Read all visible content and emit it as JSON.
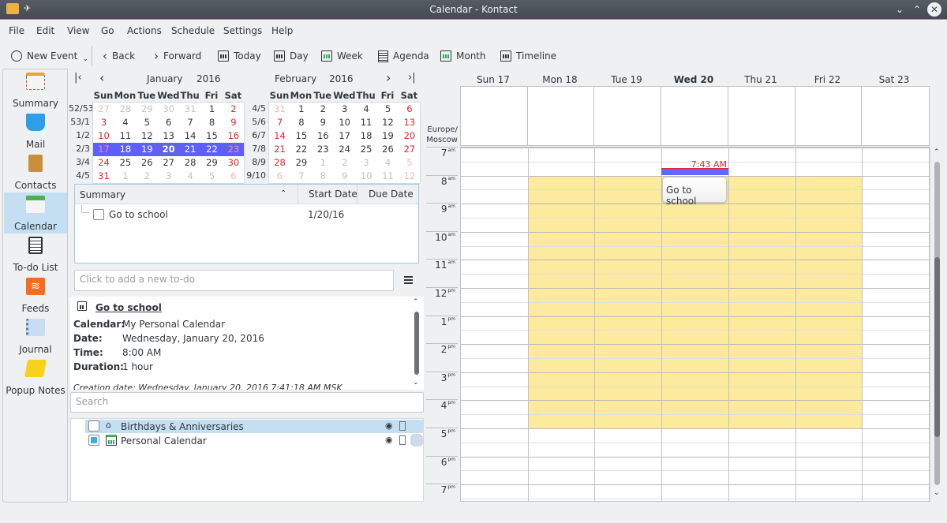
{
  "window": {
    "title": "Calendar - Kontact"
  },
  "menu": [
    "File",
    "Edit",
    "View",
    "Go",
    "Actions",
    "Schedule",
    "Settings",
    "Help"
  ],
  "toolbar": {
    "new_event": "New Event",
    "back": "Back",
    "forward": "Forward",
    "today": "Today",
    "day": "Day",
    "week": "Week",
    "agenda": "Agenda",
    "month": "Month",
    "timeline": "Timeline"
  },
  "sidebar": [
    {
      "label": "Summary",
      "icon": "summary-icon"
    },
    {
      "label": "Mail",
      "icon": "mail-icon"
    },
    {
      "label": "Contacts",
      "icon": "contacts-icon"
    },
    {
      "label": "Calendar",
      "icon": "calendar-icon",
      "active": true
    },
    {
      "label": "To-do List",
      "icon": "todo-icon"
    },
    {
      "label": "Feeds",
      "icon": "feeds-icon"
    },
    {
      "label": "Journal",
      "icon": "journal-icon"
    },
    {
      "label": "Popup Notes",
      "icon": "popup-notes-icon"
    }
  ],
  "mini_calendar": {
    "day_headers": [
      "Sun",
      "Mon",
      "Tue",
      "Wed",
      "Thu",
      "Fri",
      "Sat"
    ],
    "months": [
      {
        "month": "January",
        "year": "2016",
        "weeks": [
          "52/53",
          "53/1",
          "1/2",
          "2/3",
          "3/4",
          "4/5"
        ],
        "days": [
          [
            27,
            28,
            29,
            30,
            31,
            1,
            2
          ],
          [
            3,
            4,
            5,
            6,
            7,
            8,
            9
          ],
          [
            10,
            11,
            12,
            13,
            14,
            15,
            16
          ],
          [
            17,
            18,
            19,
            20,
            21,
            22,
            23
          ],
          [
            24,
            25,
            26,
            27,
            28,
            29,
            30
          ],
          [
            31,
            1,
            2,
            3,
            4,
            5,
            6
          ]
        ],
        "first_in": 5,
        "last_in": 36,
        "selected_week": 3,
        "today": 20
      },
      {
        "month": "February",
        "year": "2016",
        "weeks": [
          "4/5",
          "5/6",
          "6/7",
          "7/8",
          "8/9",
          "9/10"
        ],
        "days": [
          [
            31,
            1,
            2,
            3,
            4,
            5,
            6
          ],
          [
            7,
            8,
            9,
            10,
            11,
            12,
            13
          ],
          [
            14,
            15,
            16,
            17,
            18,
            19,
            20
          ],
          [
            21,
            22,
            23,
            24,
            25,
            26,
            27
          ],
          [
            28,
            29,
            1,
            2,
            3,
            4,
            5
          ],
          [
            6,
            7,
            8,
            9,
            10,
            11,
            12
          ]
        ],
        "first_in": 1,
        "last_in": 29
      }
    ]
  },
  "todo": {
    "columns": [
      "Summary",
      "Start Date",
      "Due Date"
    ],
    "items": [
      {
        "summary": "Go to school",
        "start": "1/20/16",
        "due": ""
      }
    ],
    "add_placeholder": "Click to add a new to-do"
  },
  "details": {
    "title": "Go to school",
    "calendar_label": "Calendar:",
    "calendar": "My Personal Calendar",
    "date_label": "Date:",
    "date": "Wednesday, January 20, 2016",
    "time_label": "Time:",
    "time": "8:00 AM",
    "duration_label": "Duration:",
    "duration": "1 hour",
    "creation": "Creation date: Wednesday, January 20, 2016 7:41:18 AM MSK"
  },
  "calendars": {
    "search_placeholder": "Search",
    "items": [
      {
        "name": "Birthdays & Anniversaries",
        "checked": false,
        "selected": true
      },
      {
        "name": "Personal Calendar",
        "checked": true,
        "selected": false
      }
    ]
  },
  "week_view": {
    "days": [
      {
        "label": "Sun 17"
      },
      {
        "label": "Mon 18"
      },
      {
        "label": "Tue 19"
      },
      {
        "label": "Wed 20",
        "today": true
      },
      {
        "label": "Thu 21"
      },
      {
        "label": "Fri 22"
      },
      {
        "label": "Sat 23"
      }
    ],
    "timezone": "Europe/ Moscow",
    "hours": [
      {
        "h": "7",
        "p": "am"
      },
      {
        "h": "8",
        "p": "am"
      },
      {
        "h": "9",
        "p": "am"
      },
      {
        "h": "10",
        "p": "am"
      },
      {
        "h": "11",
        "p": "am"
      },
      {
        "h": "12",
        "p": "pm"
      },
      {
        "h": "1",
        "p": "pm"
      },
      {
        "h": "2",
        "p": "pm"
      },
      {
        "h": "3",
        "p": "pm"
      },
      {
        "h": "4",
        "p": "pm"
      },
      {
        "h": "5",
        "p": "pm"
      },
      {
        "h": "6",
        "p": "pm"
      },
      {
        "h": "7",
        "p": "pm"
      }
    ],
    "current_time": "7:43 AM",
    "event": {
      "title": "Go to school",
      "day": 3
    },
    "colors": {
      "work": "#feea9c",
      "now": "#e0262b",
      "event_bar": "#6464ff"
    }
  }
}
